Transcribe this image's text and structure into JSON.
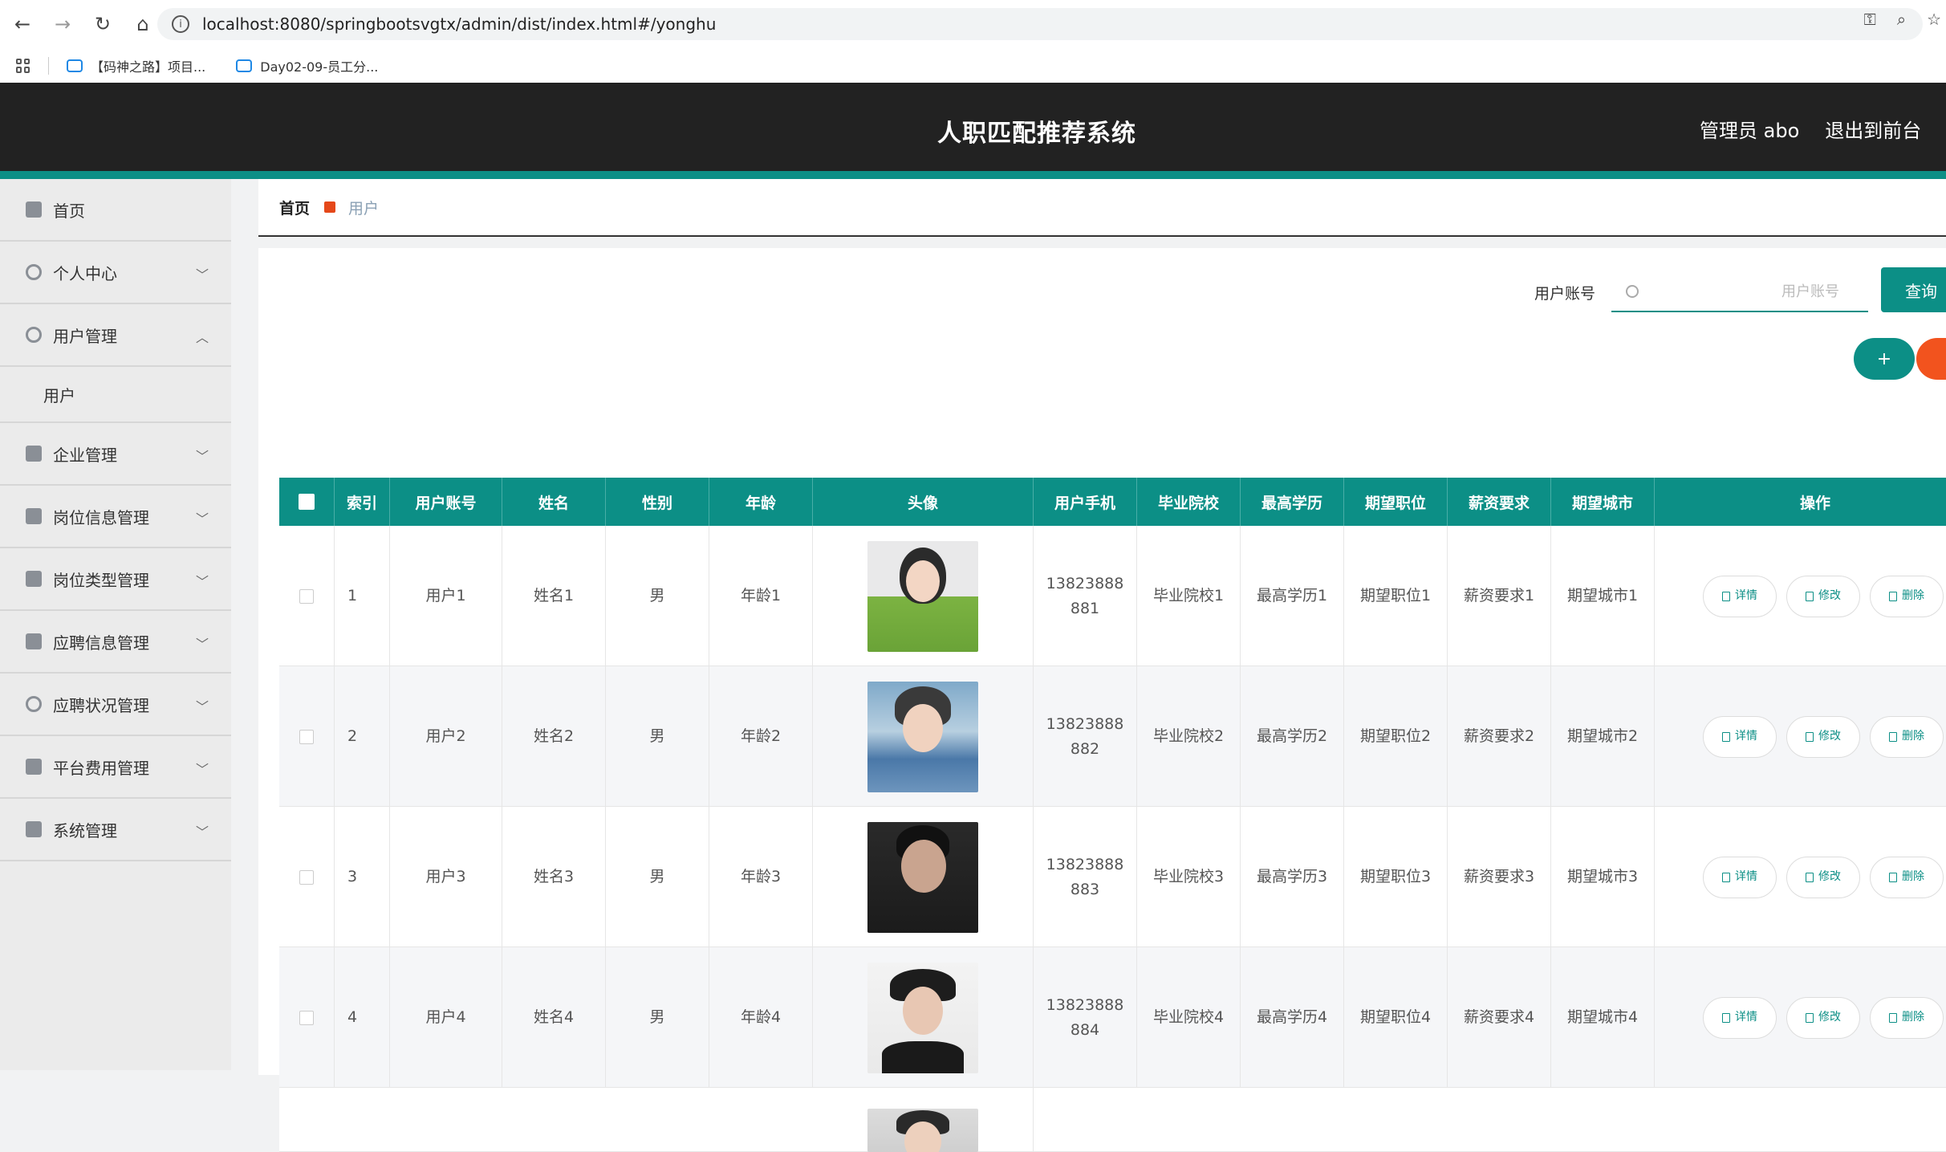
{
  "browser": {
    "url": "localhost:8080/springbootsvgtx/admin/dist/index.html#/yonghu",
    "bookmarks": [
      "【码神之路】项目...",
      "Day02-09-员工分..."
    ]
  },
  "header": {
    "title": "人职匹配推荐系统",
    "user": "管理员 abo",
    "to_front": "退出到前台",
    "logout_partial": "退"
  },
  "sidebar": {
    "items": [
      {
        "label": "首页"
      },
      {
        "label": "个人中心"
      },
      {
        "label": "用户管理"
      },
      {
        "label": "企业管理"
      },
      {
        "label": "岗位信息管理"
      },
      {
        "label": "岗位类型管理"
      },
      {
        "label": "应聘信息管理"
      },
      {
        "label": "应聘状况管理"
      },
      {
        "label": "平台费用管理"
      },
      {
        "label": "系统管理"
      }
    ],
    "sub_item": "用户"
  },
  "breadcrumb": {
    "home": "首页",
    "current": "用户"
  },
  "search": {
    "label": "用户账号",
    "placeholder": "用户账号",
    "button": "查询"
  },
  "toolbar": {
    "add": "+"
  },
  "table": {
    "headers": [
      "",
      "索引",
      "用户账号",
      "姓名",
      "性别",
      "年龄",
      "头像",
      "用户手机",
      "毕业院校",
      "最高学历",
      "期望职位",
      "薪资要求",
      "期望城市",
      "操作"
    ],
    "rows": [
      {
        "index": "1",
        "account": "用户1",
        "name": "姓名1",
        "gender": "男",
        "age": "年龄1",
        "phone1": "13823888",
        "phone2": "881",
        "school": "毕业院校1",
        "edu": "最高学历1",
        "job": "期望职位1",
        "salary": "薪资要求1",
        "city": "期望城市1"
      },
      {
        "index": "2",
        "account": "用户2",
        "name": "姓名2",
        "gender": "男",
        "age": "年龄2",
        "phone1": "13823888",
        "phone2": "882",
        "school": "毕业院校2",
        "edu": "最高学历2",
        "job": "期望职位2",
        "salary": "薪资要求2",
        "city": "期望城市2"
      },
      {
        "index": "3",
        "account": "用户3",
        "name": "姓名3",
        "gender": "男",
        "age": "年龄3",
        "phone1": "13823888",
        "phone2": "883",
        "school": "毕业院校3",
        "edu": "最高学历3",
        "job": "期望职位3",
        "salary": "薪资要求3",
        "city": "期望城市3"
      },
      {
        "index": "4",
        "account": "用户4",
        "name": "姓名4",
        "gender": "男",
        "age": "年龄4",
        "phone1": "13823888",
        "phone2": "884",
        "school": "毕业院校4",
        "edu": "最高学历4",
        "job": "期望职位4",
        "salary": "薪资要求4",
        "city": "期望城市4"
      }
    ],
    "actions": {
      "detail": "详情",
      "edit": "修改",
      "delete": "删除"
    }
  }
}
